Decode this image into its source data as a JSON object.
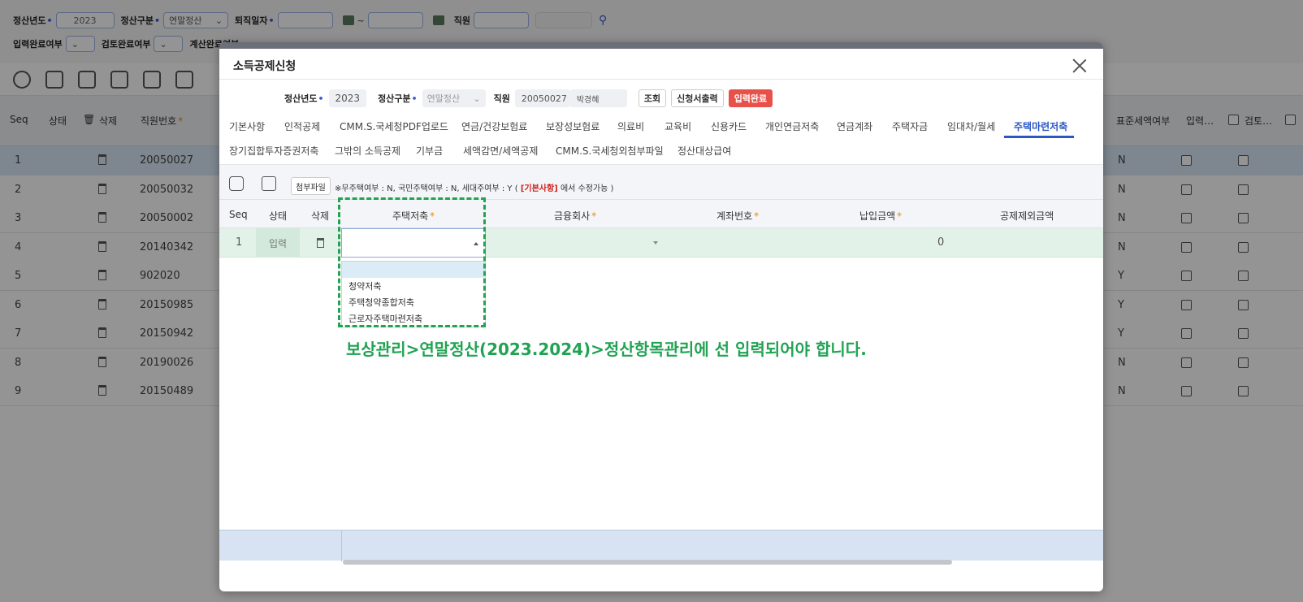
{
  "background": {
    "filters": {
      "year_label": "정산년도",
      "year_value": "2023",
      "type_label": "정산구분",
      "type_value": "연말정산",
      "retire_label": "퇴직일자",
      "tilde": "~",
      "employee_label": "직원",
      "input_done_label": "입력완료여부",
      "review_done_label": "검토완료여부",
      "calc_done_label": "계산완료여부"
    },
    "grid": {
      "headers": {
        "seq": "Seq",
        "status": "상태",
        "delete": "삭제",
        "empno": "직원번호",
        "standard_tax": "표준세액여부",
        "input": "입력…",
        "review": "검토…"
      },
      "rows": [
        {
          "seq": "1",
          "empno": "20050027",
          "std": "N"
        },
        {
          "seq": "2",
          "empno": "20050032",
          "std": "N"
        },
        {
          "seq": "3",
          "empno": "20050002",
          "std": "N"
        },
        {
          "seq": "4",
          "empno": "20140342",
          "std": "N"
        },
        {
          "seq": "5",
          "empno": "902020",
          "std": "Y"
        },
        {
          "seq": "6",
          "empno": "20150985",
          "std": "Y"
        },
        {
          "seq": "7",
          "empno": "20150942",
          "std": "Y"
        },
        {
          "seq": "8",
          "empno": "20190026",
          "std": "N"
        },
        {
          "seq": "9",
          "empno": "20150489",
          "std": "N"
        }
      ]
    }
  },
  "modal": {
    "title": "소득공제신청",
    "search": {
      "year_label": "정산년도",
      "year_value": "2023",
      "type_label": "정산구분",
      "type_value": "연말정산",
      "employee_label": "직원",
      "employee_id": "20050027",
      "employee_name": "박경혜",
      "btn_search": "조회",
      "btn_print": "신청서출력",
      "btn_done": "입력완료"
    },
    "tabs_row1": [
      "기본사항",
      "인적공제",
      "CMM.S.국세청PDF업로드",
      "연금/건강보험료",
      "보장성보험료",
      "의료비",
      "교육비",
      "신용카드",
      "개인연금저축",
      "연금계좌",
      "주택자금",
      "임대차/월세",
      "주택마련저축"
    ],
    "tabs_row2": [
      "장기집합투자증권저축",
      "그밖의 소득공제",
      "기부금",
      "세액감면/세액공제",
      "CMM.S.국세청외첨부파일",
      "정산대상급여"
    ],
    "active_tab": "주택마련저축",
    "panel": {
      "attach_btn": "첨부파일",
      "note_prefix": "※무주택여부 : N, 국민주택여부 : N, 세대주여부 : Y ( ",
      "note_link": "[기본사항]",
      "note_suffix": " 에서 수정가능 )"
    },
    "grid": {
      "headers": {
        "seq": "Seq",
        "status": "상태",
        "delete": "삭제",
        "savings": "주택저축",
        "bank": "금융회사",
        "account": "계좌번호",
        "amount": "납입금액",
        "excluded": "공제제외금액"
      },
      "row": {
        "seq": "1",
        "status": "입력",
        "amount": "0"
      },
      "dropdown_options": [
        "",
        "청약저축",
        "주택청약종합저축",
        "근로자주택마련저축"
      ]
    },
    "annotation": "보상관리>연말정산(2023.2024)>정산항목관리에 선 입력되어야 합니다."
  }
}
